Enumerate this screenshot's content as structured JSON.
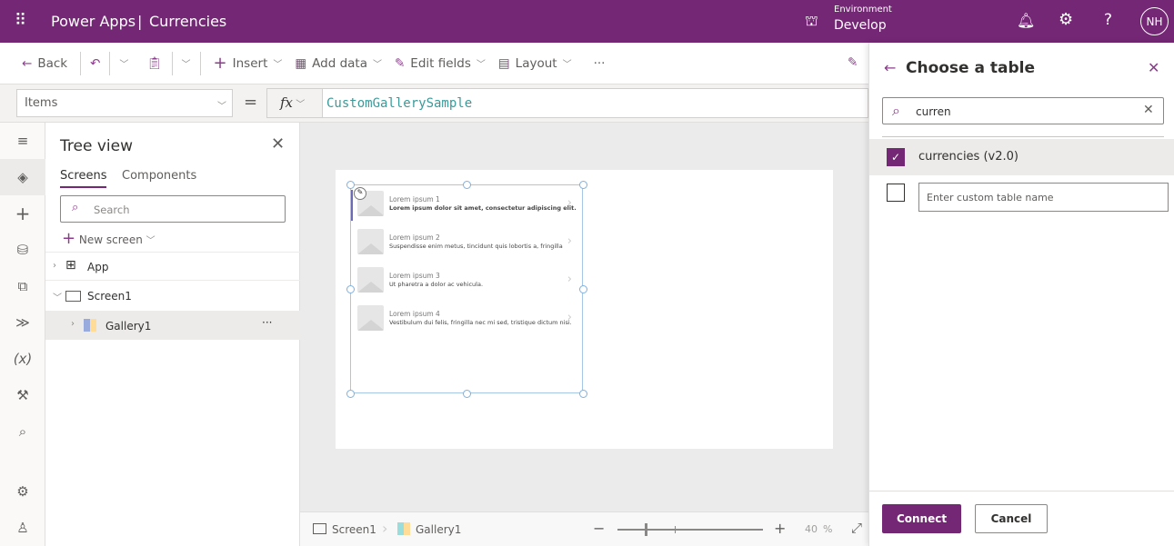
{
  "header": {
    "app": "Power Apps",
    "separator": "|",
    "title": "Currencies",
    "env_label": "Environment",
    "env_name": "Develop",
    "avatar": "NH"
  },
  "command_bar": {
    "back": "Back",
    "insert": "Insert",
    "add_data": "Add data",
    "edit_fields": "Edit fields",
    "layout": "Layout",
    "more": "···"
  },
  "formula": {
    "property": "Items",
    "equals": "=",
    "fx": "fx",
    "value": "CustomGallerySample"
  },
  "tree": {
    "title": "Tree view",
    "tabs": [
      "Screens",
      "Components"
    ],
    "search_placeholder": "Search",
    "new_screen": "New screen",
    "nodes": [
      "App",
      "Screen1",
      "Gallery1"
    ],
    "more": "···"
  },
  "gallery": {
    "items": [
      {
        "title": "Lorem ipsum 1",
        "subtitle": "Lorem ipsum dolor sit amet, consectetur adipiscing elit."
      },
      {
        "title": "Lorem ipsum 2",
        "subtitle": "Suspendisse enim metus, tincidunt quis lobortis a, fringilla"
      },
      {
        "title": "Lorem ipsum 3",
        "subtitle": "Ut pharetra a dolor ac vehicula."
      },
      {
        "title": "Lorem ipsum 4",
        "subtitle": "Vestibulum dui felis, fringilla nec mi sed, tristique dictum nisi."
      }
    ]
  },
  "status": {
    "screen": "Screen1",
    "gallery": "Gallery1",
    "zoom": "40",
    "pct": "%",
    "zoom_value": 40
  },
  "panel": {
    "title": "Choose a table",
    "search": "curren",
    "options": [
      {
        "label": "currencies (v2.0)",
        "checked": true
      }
    ],
    "custom_placeholder": "Enter custom table name",
    "connect": "Connect",
    "cancel": "Cancel"
  },
  "colors": {
    "brand": "#742774",
    "formula": "#3a9a9a"
  }
}
